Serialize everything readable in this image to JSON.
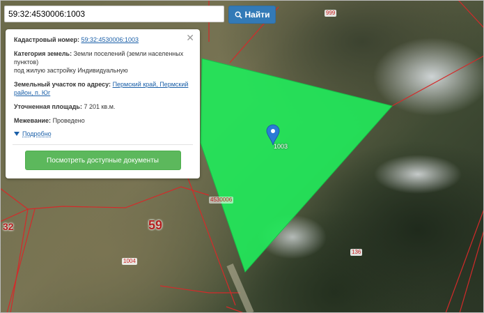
{
  "search": {
    "value": "59:32:4530006:1003",
    "button_label": "Найти"
  },
  "info": {
    "cadastral_label": "Кадастровый номер:",
    "cadastral_number": "59:32:4530006:1003",
    "category_label": "Категория земель:",
    "category_value": "Земли поселений (земли населенных пунктов)",
    "category_value2": "под жилую застройку Индивидуальную",
    "address_label": "Земельный участок по адресу:",
    "address_value": "Пермский край, Пермский район, п. Юг",
    "area_label": "Уточненная площадь:",
    "area_value": "7 201 кв.м.",
    "survey_label": "Межевание:",
    "survey_value": "Проведено",
    "more_label": "Подробно",
    "docs_button": "Посмотреть доступные документы"
  },
  "map_labels": {
    "parcel_999": "999",
    "parcel_1003": "1003",
    "quarter_4530006": "4530006",
    "district_59": "59",
    "district_32": "32",
    "parcel_1004": "1004",
    "parcel_136": "136"
  },
  "colors": {
    "parcel_fill": "#22e85a",
    "boundary": "#d42a2a",
    "marker": "#2b7bd6"
  }
}
